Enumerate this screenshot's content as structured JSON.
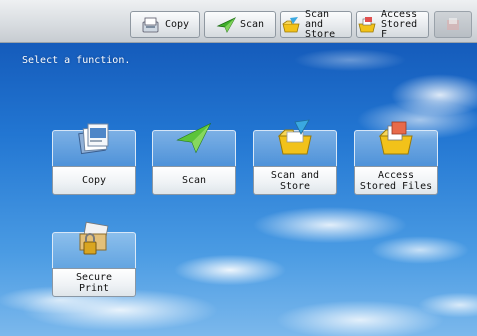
{
  "toolbar": {
    "copy_label": "Copy",
    "scan_label": "Scan",
    "scan_store_label": "Scan and\nStore",
    "access_label": "Access\nStored F"
  },
  "message": "Select a function.",
  "functions": [
    {
      "label": "Copy",
      "icon": "copy-icon"
    },
    {
      "label": "Scan",
      "icon": "scan-icon"
    },
    {
      "label": "Scan and\nStore",
      "icon": "scan-and-store-icon"
    },
    {
      "label": "Access\nStored Files",
      "icon": "access-stored-files-icon"
    },
    {
      "label": "Secure\nPrint",
      "icon": "secure-print-icon"
    }
  ],
  "colors": {
    "sky_top": "#0f4fb0",
    "sky_bottom": "#7bb8ec",
    "toolbar": "#d9dde1",
    "scan_green": "#3fae2a",
    "folder_yellow": "#f2c21a"
  }
}
